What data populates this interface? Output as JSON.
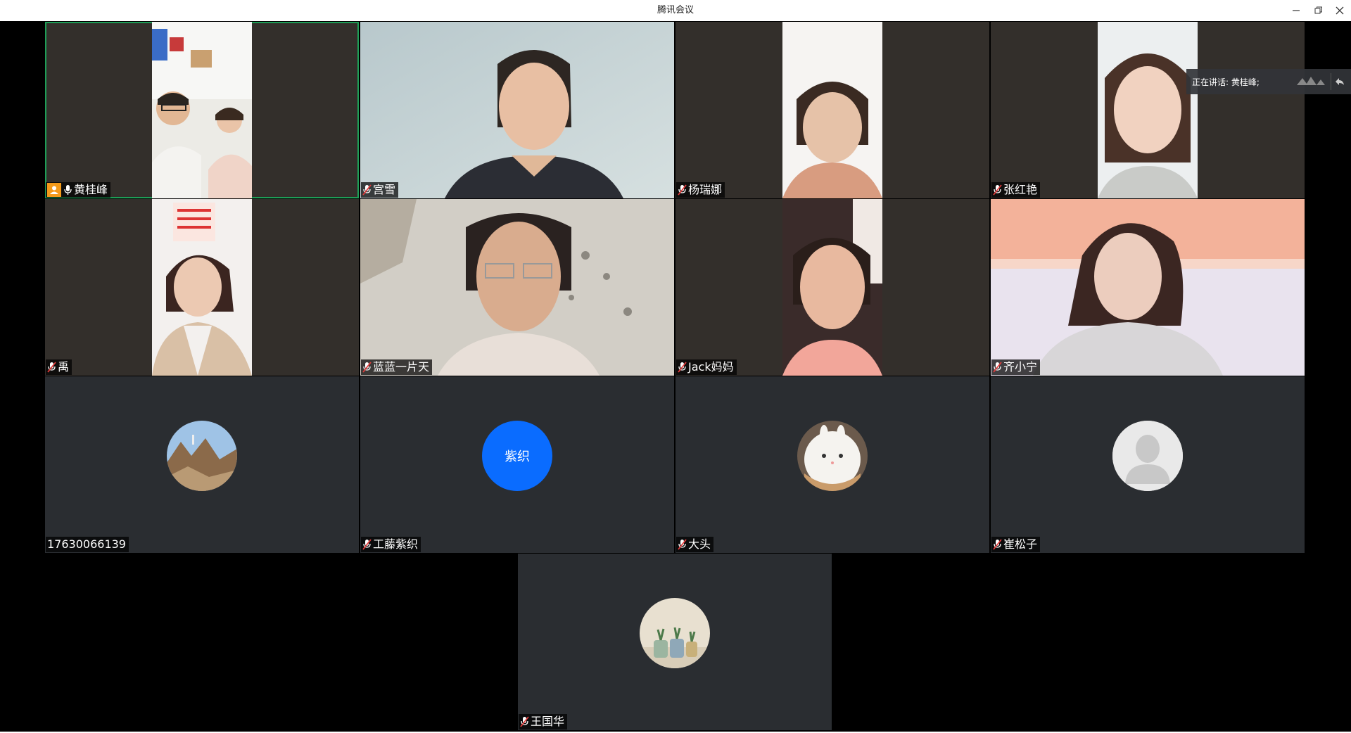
{
  "window": {
    "title": "腾讯会议"
  },
  "speaking": {
    "label": "正在讲话: 黄桂峰;"
  },
  "participants": [
    {
      "name": "黄桂峰",
      "type": "video",
      "host": true,
      "muted": false,
      "active": true
    },
    {
      "name": "宫雪",
      "type": "video",
      "muted": true
    },
    {
      "name": "杨瑞娜",
      "type": "video",
      "muted": true
    },
    {
      "name": "张红艳",
      "type": "video",
      "muted": true
    },
    {
      "name": "禹",
      "type": "video",
      "muted": true
    },
    {
      "name": "蓝蓝一片天",
      "type": "video",
      "muted": true
    },
    {
      "name": "Jack妈妈",
      "type": "video",
      "muted": true
    },
    {
      "name": "齐小宁",
      "type": "video",
      "muted": true
    },
    {
      "name": "17630066139",
      "type": "avatar",
      "muted": false,
      "avatar": "photo-rocks"
    },
    {
      "name": "工藤紫织",
      "type": "avatar",
      "muted": true,
      "avatar": "text",
      "avatar_text": "紫织",
      "avatar_color": "#0a6cff"
    },
    {
      "name": "大头",
      "type": "avatar",
      "muted": true,
      "avatar": "photo-bunny"
    },
    {
      "name": "崔松子",
      "type": "avatar",
      "muted": true,
      "avatar": "default-person"
    },
    {
      "name": "王国华",
      "type": "avatar",
      "muted": true,
      "avatar": "photo-plants"
    }
  ],
  "colors": {
    "active_border": "#1e9e57",
    "host_badge": "#f39a1a",
    "tile_bg": "#2a2d31"
  }
}
